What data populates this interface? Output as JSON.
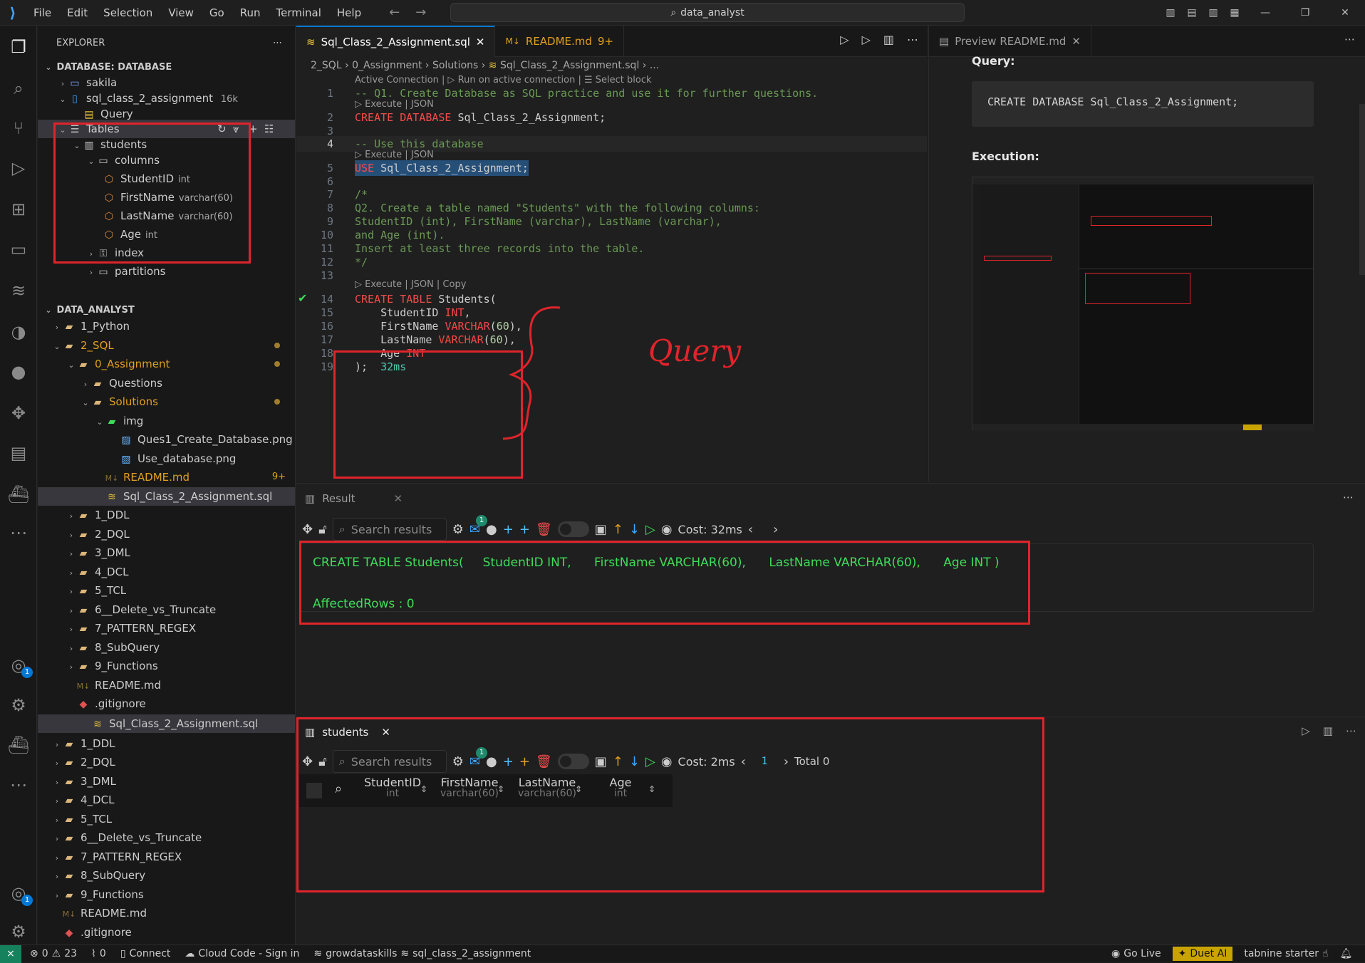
{
  "titlebar": {
    "menus": [
      "File",
      "Edit",
      "Selection",
      "View",
      "Go",
      "Run",
      "Terminal",
      "Help"
    ],
    "search": "data_analyst"
  },
  "sidebar": {
    "title": "EXPLORER",
    "db_section": "DATABASE: DATABASE",
    "db_items": [
      "sakila",
      "sql_class_2_assignment",
      "16k",
      "Query",
      "Tables",
      "students",
      "columns",
      "index",
      "partitions"
    ],
    "columns": [
      {
        "name": "StudentID",
        "type": "int"
      },
      {
        "name": "FirstName",
        "type": "varchar(60)"
      },
      {
        "name": "LastName",
        "type": "varchar(60)"
      },
      {
        "name": "Age",
        "type": "int"
      }
    ],
    "project_section": "DATA_ANALYST",
    "project_items": [
      "1_Python",
      "2_SQL",
      "0_Assignment",
      "Questions",
      "Solutions",
      "img",
      "Ques1_Create_Database.png",
      "Use_database.png",
      "README.md",
      "9+",
      "Sql_Class_2_Assignment.sql",
      "1_DDL",
      "2_DQL",
      "3_DML",
      "4_DCL",
      "5_TCL",
      "6__Delete_vs_Truncate",
      "7_PATTERN_REGEX",
      "8_SubQuery",
      "9_Functions",
      "README.md",
      ".gitignore",
      "Sql_Class_2_Assignment.sql",
      "1_DDL",
      "2_DQL",
      "3_DML",
      "4_DCL",
      "5_TCL",
      "6__Delete_vs_Truncate",
      "7_PATTERN_REGEX",
      "8_SubQuery",
      "9_Functions",
      "README.md",
      ".gitignore"
    ]
  },
  "editor": {
    "tabs": [
      {
        "label": "Sql_Class_2_Assignment.sql",
        "active": true
      },
      {
        "label": "README.md",
        "suffix": "9+",
        "active": false
      }
    ],
    "breadcrumb": [
      "2_SQL",
      "0_Assignment",
      "Solutions",
      "Sql_Class_2_Assignment.sql",
      "..."
    ],
    "lens_top": "Active Connection |  ▷ Run on active connection |  ☰ Select block",
    "lens_exec": "▷ Execute | JSON",
    "lens_exec_copy": "▷ Execute | JSON | Copy",
    "lines": [
      {
        "n": "1",
        "t": "-- Q1. Create Database as SQL practice and use it for further questions."
      },
      {
        "n": "2",
        "t": "CREATE DATABASE Sql_Class_2_Assignment;"
      },
      {
        "n": "3",
        "t": ""
      },
      {
        "n": "4",
        "t": "-- Use this database"
      },
      {
        "n": "5",
        "t": "USE Sql_Class_2_Assignment;"
      },
      {
        "n": "6",
        "t": ""
      },
      {
        "n": "7",
        "t": "/*"
      },
      {
        "n": "8",
        "t": "Q2. Create a table named \"Students\" with the following columns:"
      },
      {
        "n": "9",
        "t": "StudentID (int), FirstName (varchar), LastName (varchar),"
      },
      {
        "n": "10",
        "t": "and Age (int)."
      },
      {
        "n": "11",
        "t": "Insert at least three records into the table."
      },
      {
        "n": "12",
        "t": "*/"
      },
      {
        "n": "13",
        "t": ""
      },
      {
        "n": "14",
        "t": "CREATE TABLE Students("
      },
      {
        "n": "15",
        "t": "    StudentID INT,"
      },
      {
        "n": "16",
        "t": "    FirstName VARCHAR(60),"
      },
      {
        "n": "17",
        "t": "    LastName VARCHAR(60),"
      },
      {
        "n": "18",
        "t": "    Age INT"
      },
      {
        "n": "19",
        "t": ");  32ms"
      }
    ],
    "annotation": "Query"
  },
  "preview": {
    "tab": "Preview README.md",
    "query_heading": "Query:",
    "query_code": "CREATE DATABASE Sql_Class_2_Assignment;",
    "execution_heading": "Execution:"
  },
  "result_panel": {
    "tab": "Result",
    "search_placeholder": "Search results",
    "cost": "Cost: 32ms",
    "badge": "1",
    "output_line": "CREATE TABLE Students(     StudentID INT,      FirstName VARCHAR(60),      LastName VARCHAR(60),      Age INT )",
    "affected": "AffectedRows : 0"
  },
  "students_panel": {
    "tab": "students",
    "search_placeholder": "Search results",
    "cost": "Cost: 2ms",
    "page": "1",
    "total": "Total 0",
    "badge": "1",
    "columns": [
      {
        "name": "StudentID",
        "type": "int"
      },
      {
        "name": "FirstName",
        "type": "varchar(60)"
      },
      {
        "name": "LastName",
        "type": "varchar(60)"
      },
      {
        "name": "Age",
        "type": "int"
      }
    ]
  },
  "status": {
    "errors": "0",
    "warnings": "23",
    "ports": "0",
    "connect": "Connect",
    "cloud": "Cloud Code - Sign in",
    "db1": "growdataskills",
    "db2": "sql_class_2_assignment",
    "golive": "Go Live",
    "duet": "Duet AI",
    "tabnine": "tabnine starter"
  },
  "activity_badge": "1"
}
